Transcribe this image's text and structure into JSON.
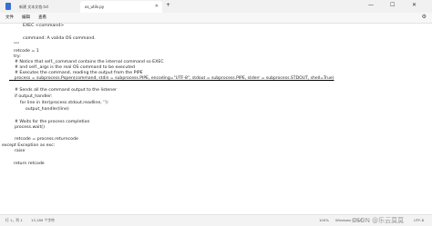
{
  "tabs": [
    {
      "label": "新建 文本文档.txt",
      "active": false
    },
    {
      "label": "os_utils.py",
      "active": true
    }
  ],
  "new_tab_label": "+",
  "window_controls": {
    "minimize": "—",
    "maximize": "☐",
    "close": "✕"
  },
  "tab_close": "✕",
  "menu": [
    "文件",
    "编辑",
    "查看"
  ],
  "code_lines": [
    "EXEC <command>",
    "",
    "command: A valida OS command.",
    "\"\"\"",
    "retcode = 1",
    "try:",
    "    # Notice that self._command contains the internal command so EXEC",
    "    # and self._args is the real OS command to be executed",
    "    # Executes the command, reading the output from the PIPE",
    "    process = subprocess.Popen(command, stdin = subprocess.PIPE, encoding=\"UTF-8\", stdout = subprocess.PIPE, stderr = subprocess.STDOUT, shell=True)",
    "",
    "    # Sends all the command output to the listener",
    "    if output_handler:",
    "        for line in iter(process.stdout.readline, ''):",
    "            output_handler(line)",
    "",
    "    # Waits for the process completion",
    "    process.wait()",
    "",
    "    retcode = process.returncode",
    "except Exception as exc:",
    "    raise",
    "",
    "return retcode"
  ],
  "status": {
    "position": "行 1，列 1",
    "chars": "13,189 个字符",
    "zoom": "100%",
    "line_ending": "Windows (CRLF)",
    "encoding": "UTF-8"
  },
  "watermark": "CSDN @乐云莫莫"
}
